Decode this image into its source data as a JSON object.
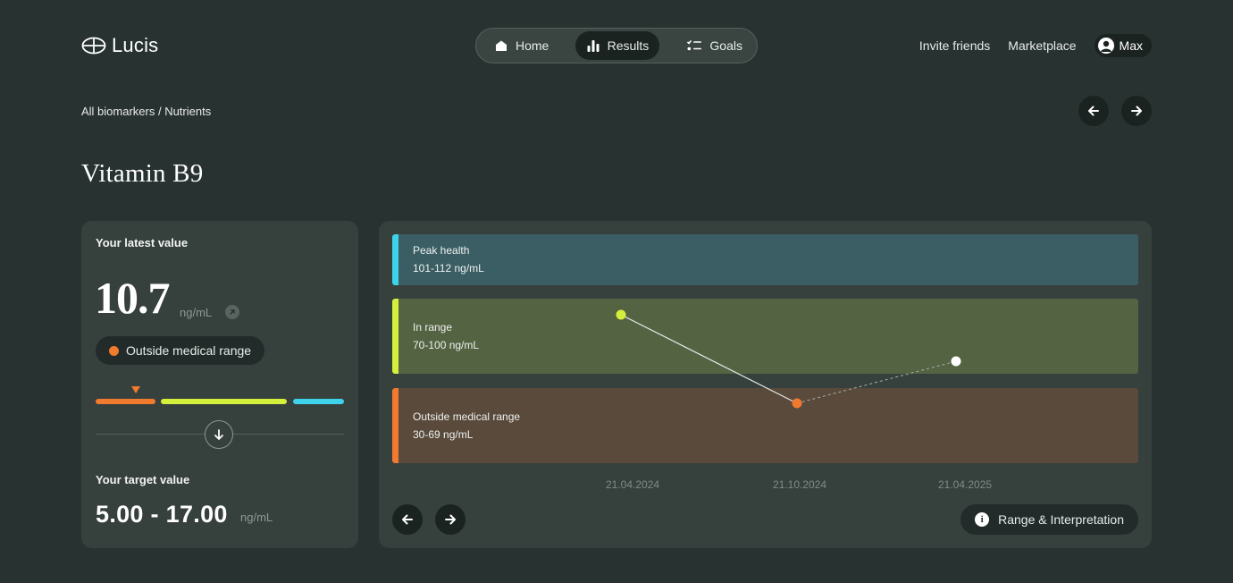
{
  "app": {
    "name": "Lucis"
  },
  "nav": {
    "home": "Home",
    "results": "Results",
    "goals": "Goals"
  },
  "header": {
    "invite": "Invite friends",
    "marketplace": "Marketplace",
    "user": "Max"
  },
  "breadcrumb": "All biomarkers / Nutrients",
  "page_title": "Vitamin B9",
  "latest": {
    "label": "Your latest value",
    "value": "10.7",
    "unit": "ng/mL",
    "status": "Outside medical range",
    "status_color": "#f07a2e"
  },
  "target": {
    "label": "Your target value",
    "value": "5.00 - 17.00",
    "unit": "ng/mL"
  },
  "colors": {
    "outside": "#f07a2e",
    "in_range": "#d4f03c",
    "peak": "#3ed3ea"
  },
  "chart_data": {
    "type": "line",
    "bands": [
      {
        "name": "Peak health",
        "range": "101-112 ng/mL",
        "color": "#3ed3ea"
      },
      {
        "name": "In range",
        "range": "70-100 ng/mL",
        "color": "#d4f03c"
      },
      {
        "name": "Outside medical range",
        "range": "30-69 ng/mL",
        "color": "#f07a2e"
      }
    ],
    "x_labels": [
      "21.04.2024",
      "21.10.2024",
      "21.04.2025"
    ],
    "points": [
      {
        "band": "In range",
        "style": "solid",
        "color": "#d4f03c"
      },
      {
        "band": "Outside medical range",
        "style": "solid",
        "color": "#f07a2e"
      },
      {
        "band": "In range",
        "style": "dashed",
        "color": "#ffffff"
      }
    ]
  },
  "chart_controls": {
    "range_button": "Range & Interpretation"
  }
}
